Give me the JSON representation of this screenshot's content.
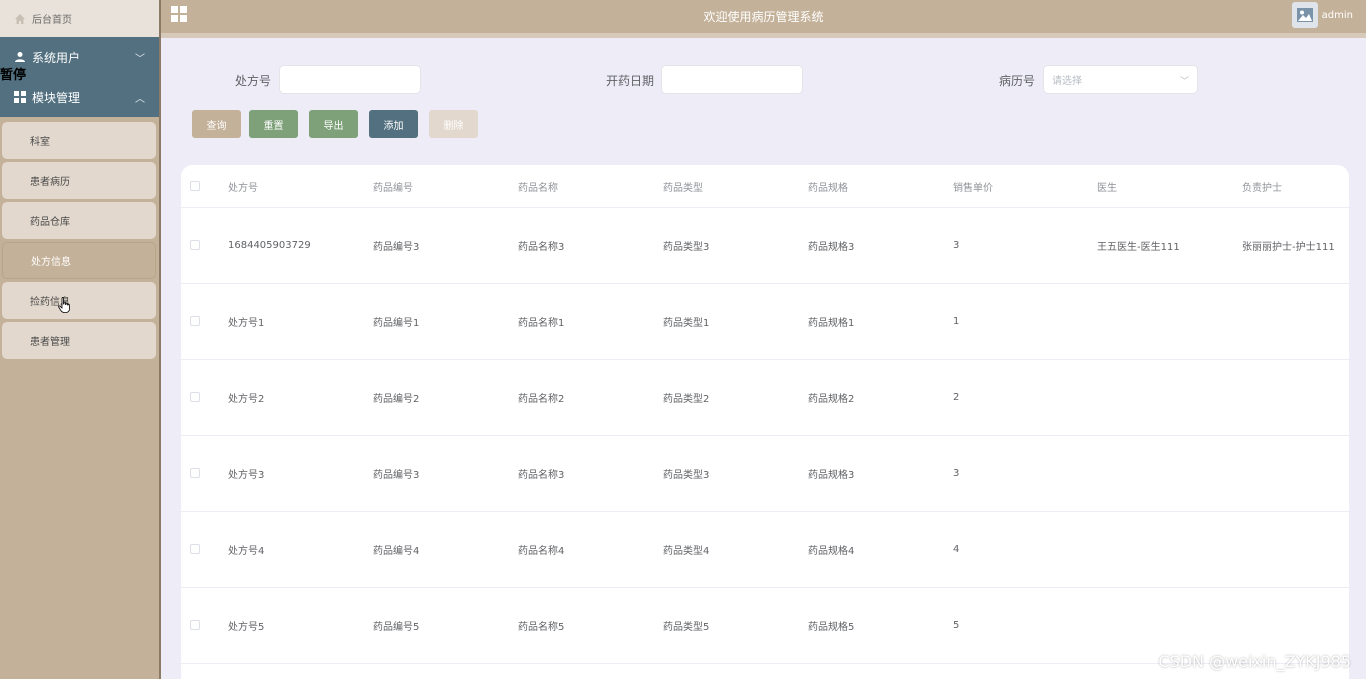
{
  "sidebar": {
    "home_label": "后台首页",
    "overlay_text": "暂停",
    "groups": [
      {
        "label": "系统用户",
        "chevron": "﹀"
      },
      {
        "label": "模块管理",
        "chevron": "︿"
      }
    ],
    "items": [
      {
        "label": "科室"
      },
      {
        "label": "患者病历"
      },
      {
        "label": "药品仓库"
      },
      {
        "label": "处方信息"
      },
      {
        "label": "捡药信息"
      },
      {
        "label": "患者管理"
      }
    ]
  },
  "topbar": {
    "title": "欢迎使用病历管理系统",
    "user": "admin"
  },
  "search": {
    "prescription_label": "处方号",
    "date_label": "开药日期",
    "record_label": "病历号",
    "record_placeholder": "请选择"
  },
  "buttons": {
    "query": "查询",
    "reset": "重置",
    "export": "导出",
    "add": "添加",
    "delete": "删除"
  },
  "table": {
    "headers": [
      "处方号",
      "药品编号",
      "药品名称",
      "药品类型",
      "药品规格",
      "销售单价",
      "医生",
      "负责护士"
    ],
    "rows": [
      [
        "1684405903729",
        "药品编号3",
        "药品名称3",
        "药品类型3",
        "药品规格3",
        "3",
        "王五医生-医生111",
        "张丽丽护士-护士111"
      ],
      [
        "处方号1",
        "药品编号1",
        "药品名称1",
        "药品类型1",
        "药品规格1",
        "1",
        "",
        ""
      ],
      [
        "处方号2",
        "药品编号2",
        "药品名称2",
        "药品类型2",
        "药品规格2",
        "2",
        "",
        ""
      ],
      [
        "处方号3",
        "药品编号3",
        "药品名称3",
        "药品类型3",
        "药品规格3",
        "3",
        "",
        ""
      ],
      [
        "处方号4",
        "药品编号4",
        "药品名称4",
        "药品类型4",
        "药品规格4",
        "4",
        "",
        ""
      ],
      [
        "处方号5",
        "药品编号5",
        "药品名称5",
        "药品类型5",
        "药品规格5",
        "5",
        "",
        ""
      ]
    ]
  },
  "watermark": "CSDN @weixin_ZYKJ985",
  "colors": {
    "primary": "#c4b199",
    "nav": "#52707f",
    "green": "#7ea179",
    "background": "#eeedf7"
  }
}
